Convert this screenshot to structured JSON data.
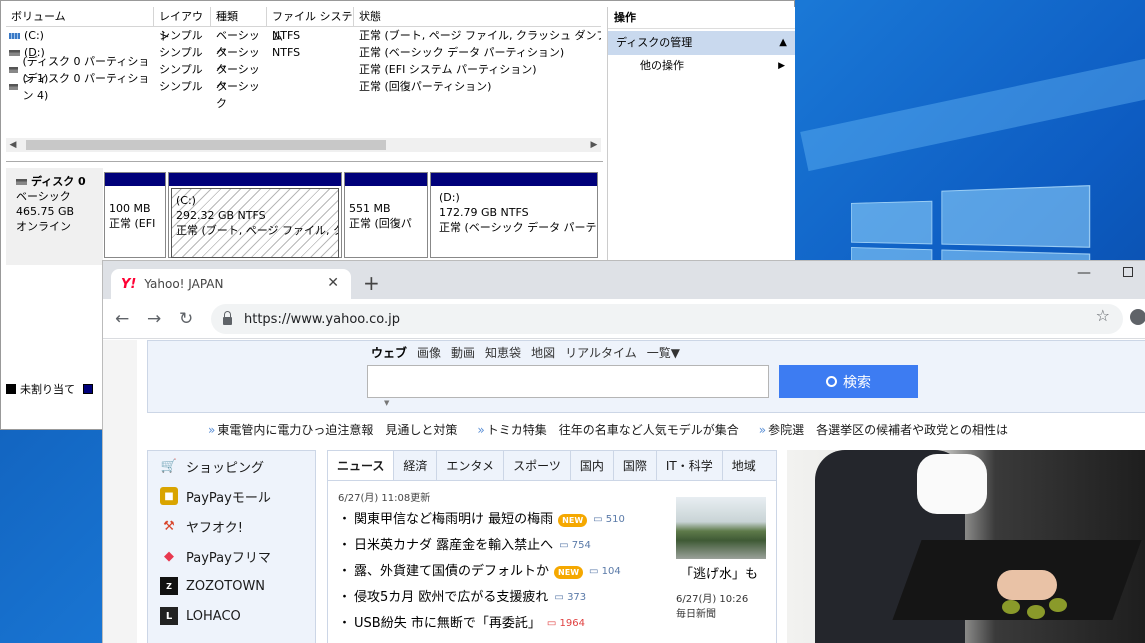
{
  "disk_mgmt": {
    "columns": [
      "ボリューム",
      "レイアウト",
      "種類",
      "ファイル システム",
      "状態"
    ],
    "volumes": [
      {
        "name": "(C:)",
        "layout": "シンプル",
        "type": "ベーシック",
        "fs": "NTFS",
        "status": "正常 (ブート, ページ ファイル, クラッシュ ダンプ, ベーシ"
      },
      {
        "name": "(D:)",
        "layout": "シンプル",
        "type": "ベーシック",
        "fs": "NTFS",
        "status": "正常 (ベーシック データ パーティション)"
      },
      {
        "name": "(ディスク 0 パーティション 1)",
        "layout": "シンプル",
        "type": "ベーシック",
        "fs": "",
        "status": "正常 (EFI システム パーティション)"
      },
      {
        "name": "(ディスク 0 パーティション 4)",
        "layout": "シンプル",
        "type": "ベーシック",
        "fs": "",
        "status": "正常 (回復パーティション)"
      }
    ],
    "disk": {
      "name": "ディスク 0",
      "type": "ベーシック",
      "size": "465.75 GB",
      "state": "オンライン"
    },
    "partitions": [
      {
        "label": "",
        "size": "100 MB",
        "status": "正常 (EFI"
      },
      {
        "label": "(C:)",
        "size": "292.32 GB NTFS",
        "status": "正常 (ブート, ページ ファイル, クラッシ"
      },
      {
        "label": "",
        "size": "551 MB",
        "status": "正常 (回復パ"
      },
      {
        "label": "(D:)",
        "size": "172.79 GB NTFS",
        "status": "正常 (ベーシック データ パーティシ"
      }
    ],
    "legend_unallocated": "未割り当て",
    "ops_title": "操作",
    "ops_section": "ディスクの管理",
    "ops_item": "他の操作"
  },
  "browser": {
    "tab_title": "Yahoo! JAPAN",
    "favicon": "Y!",
    "url": "https://www.yahoo.co.jp",
    "search_tabs": [
      "ウェブ",
      "画像",
      "動画",
      "知恵袋",
      "地図",
      "リアルタイム",
      "一覧▼"
    ],
    "search_button": "検索",
    "headlines": [
      "東電管内に電力ひっ迫注意報　見通しと対策",
      "トミカ特集　往年の名車など人気モデルが集合",
      "参院選　各選挙区の候補者や政党との相性は"
    ],
    "services": [
      "ショッピング",
      "PayPayモール",
      "ヤフオク!",
      "PayPayフリマ",
      "ZOZOTOWN",
      "LOHACO"
    ],
    "news_tabs": [
      "ニュース",
      "経済",
      "エンタメ",
      "スポーツ",
      "国内",
      "国際",
      "IT・科学",
      "地域"
    ],
    "news_date": "6/27(月) 11:08更新",
    "news": [
      {
        "text": "関東甲信など梅雨明け 最短の梅雨",
        "new": true,
        "count": "510",
        "hot": false
      },
      {
        "text": "日米英カナダ 露産金を輸入禁止へ",
        "new": false,
        "count": "754",
        "hot": false
      },
      {
        "text": "露、外貨建て国債のデフォルトか",
        "new": true,
        "count": "104",
        "hot": false
      },
      {
        "text": "侵攻5カ月 欧州で広がる支援疲れ",
        "new": false,
        "count": "373",
        "hot": false
      },
      {
        "text": "USB紛失 市に無断で「再委託」",
        "new": false,
        "count": "1964",
        "hot": true
      }
    ],
    "new_badge": "NEW",
    "feature_caption": "「逃げ水」も",
    "feature_time": "6/27(月) 10:26",
    "feature_source": "毎日新聞"
  }
}
